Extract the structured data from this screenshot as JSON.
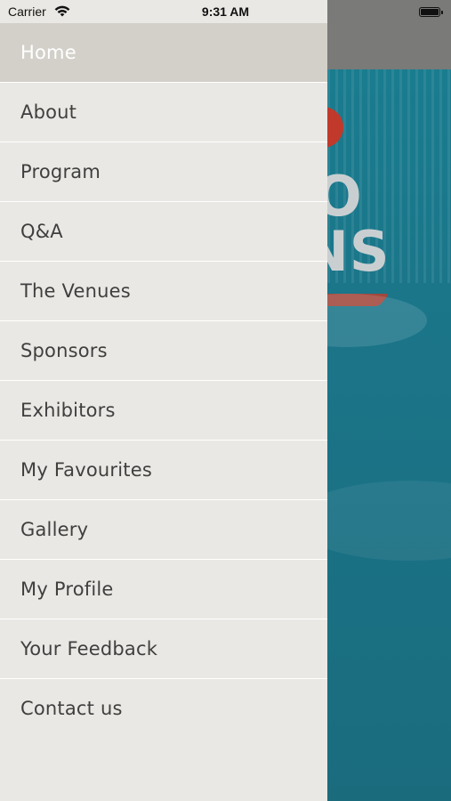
{
  "status_bar": {
    "carrier": "Carrier",
    "time": "9:31 AM"
  },
  "background": {
    "logo_text_line1": "O",
    "logo_text_line2": "NS"
  },
  "menu": {
    "items": [
      {
        "label": "Home",
        "active": true
      },
      {
        "label": "About"
      },
      {
        "label": "Program"
      },
      {
        "label": "Q&A"
      },
      {
        "label": "The Venues"
      },
      {
        "label": "Sponsors"
      },
      {
        "label": "Exhibitors"
      },
      {
        "label": "My Favourites"
      },
      {
        "label": "Gallery"
      },
      {
        "label": "My Profile"
      },
      {
        "label": "Your Feedback"
      },
      {
        "label": "Contact us"
      }
    ]
  },
  "colors": {
    "drawer_bg": "#eae8e4",
    "active_item_bg": "#d3d0c9",
    "item_text": "#3f3f3f",
    "active_text": "#ffffff",
    "background_teal": "#1b7488"
  }
}
